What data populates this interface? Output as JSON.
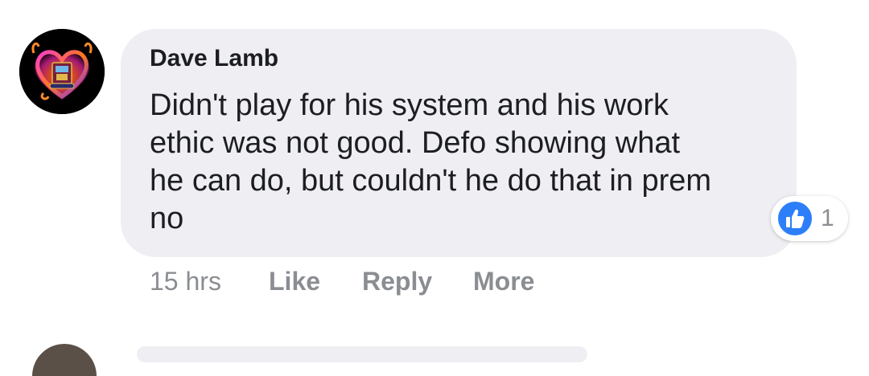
{
  "comment": {
    "author": "Dave Lamb",
    "text_lines": [
      "Didn't play for his system and his work",
      "ethic was not good. Defo showing what",
      "he can do, but couldn't he do that in prem",
      "no"
    ],
    "timestamp": "15 hrs",
    "actions": {
      "like": "Like",
      "reply": "Reply",
      "more": "More"
    },
    "reactions": {
      "icon": "thumbs-up-icon",
      "count": "1",
      "color": "#2d7ff9"
    },
    "avatar": {
      "icon": "flaming-heart-crest-avatar"
    }
  }
}
